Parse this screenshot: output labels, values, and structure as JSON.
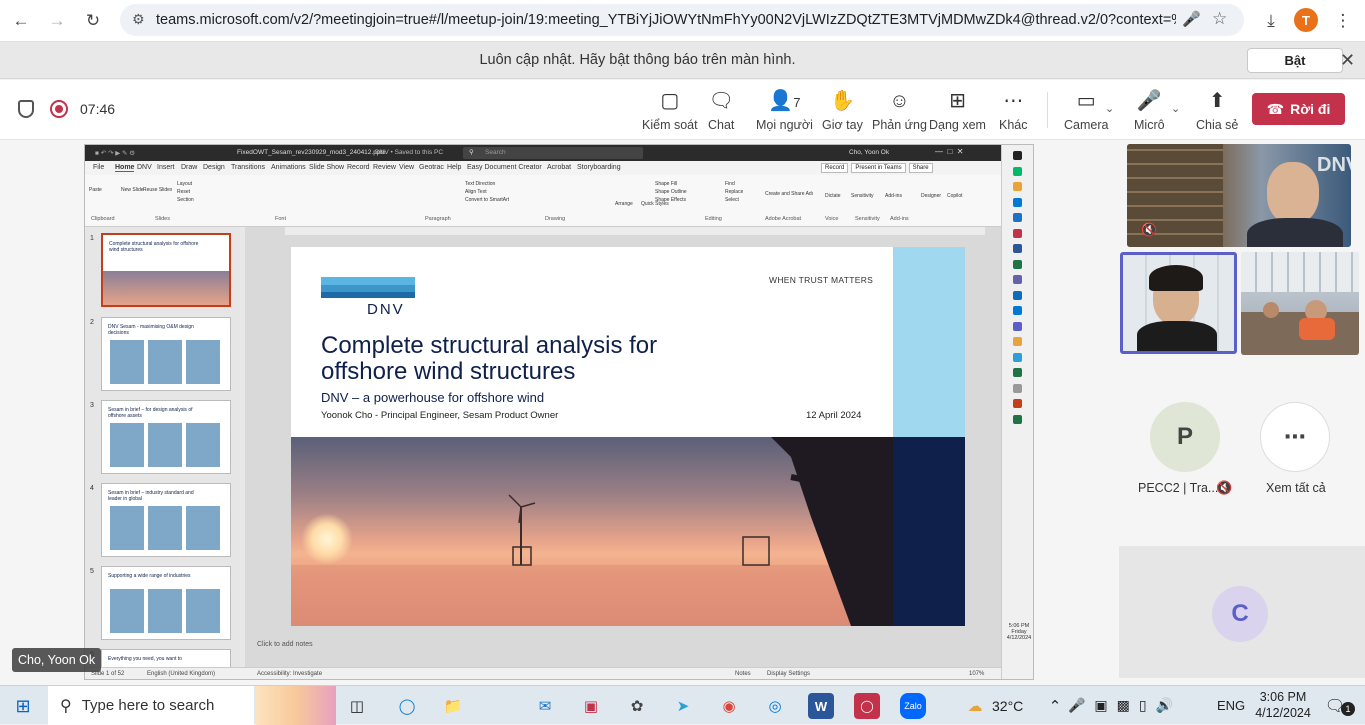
{
  "browser": {
    "url": "teams.microsoft.com/v2/?meetingjoin=true#/l/meetup-join/19:meeting_YTBiYjJiOWYtNmFhYy00N2VjLWIzZDQtZTE3MTVjMDMwZDk4@thread.v2/0?context=%7b\"...",
    "profile_initial": "T"
  },
  "notification": {
    "message": "Luôn cập nhật. Hãy bật thông báo trên màn hình.",
    "button": "Bật"
  },
  "meeting": {
    "timer": "07:46",
    "toolbar": {
      "control": "Kiểm soát",
      "chat": "Chat",
      "people": "Mọi người",
      "people_count": "7",
      "raise": "Giơ tay",
      "react": "Phản ứng",
      "view": "Dạng xem",
      "more": "Khác",
      "camera": "Camera",
      "mic": "Micrô",
      "share": "Chia sẻ",
      "leave": "Rời đi"
    },
    "presenter_name": "Cho, Yoon Ok",
    "participant_p_initial": "P",
    "participant_p_name": "PECC2 | Tra...",
    "see_all": "Xem tất cả",
    "participant_c_initial": "C",
    "dnv_wall_text": "DNV"
  },
  "powerpoint": {
    "filename": "FixedOWT_Sesam_rev230929_mod3_240412.pptx",
    "saved": "DNV • Saved to this PC",
    "search": "Search",
    "user": "Cho, Yoon Ok",
    "menu": [
      "File",
      "Home",
      "DNV",
      "Insert",
      "Draw",
      "Design",
      "Transitions",
      "Animations",
      "Slide Show",
      "Record",
      "Review",
      "View",
      "Geotrac",
      "Help",
      "Easy Document Creator",
      "Acrobat",
      "Storyboarding"
    ],
    "record_btn": "Record",
    "present_btn": "Present in Teams",
    "share_btn": "Share",
    "ribbon_groups": [
      "Clipboard",
      "Slides",
      "Font",
      "Paragraph",
      "Drawing",
      "Editing",
      "Adobe Acrobat",
      "Voice",
      "Sensitivity",
      "Add-ins"
    ],
    "ribbon_buttons": [
      "Paste",
      "New Slide",
      "Reuse Slides",
      "Layout",
      "Reset",
      "Section",
      "Text Direction",
      "Align Text",
      "Convert to SmartArt",
      "Arrange",
      "Quick Styles",
      "Shape Fill",
      "Shape Outline",
      "Shape Effects",
      "Find",
      "Replace",
      "Select",
      "Create and Share Adobe PDF",
      "Dictate",
      "Sensitivity",
      "Add-ins",
      "Designer",
      "Copilot"
    ],
    "thumbnails": [
      {
        "num": "1",
        "title": "Complete structural analysis for offshore wind structures"
      },
      {
        "num": "2",
        "title": "DNV Sesam - maximising O&M design decisions"
      },
      {
        "num": "3",
        "title": "Sesam in brief – for design analysis of offshore assets"
      },
      {
        "num": "4",
        "title": "Sesam in brief – industry standard and leader in global"
      },
      {
        "num": "5",
        "title": "Supporting a wide range of industries"
      },
      {
        "num": "6",
        "title": "Everything you need, you want to"
      }
    ],
    "notes": "Click to add notes",
    "status_slide": "Slide 1 of 52",
    "status_lang": "English (United Kingdom)",
    "status_access": "Accessibility: Investigate",
    "status_notes": "Notes",
    "status_display": "Display Settings",
    "status_zoom": "107%",
    "clock_side": "5:06 PM",
    "day_side": "Friday",
    "date_side": "4/12/2024"
  },
  "slide": {
    "logo": "DNV",
    "tagline": "WHEN TRUST MATTERS",
    "title_line1": "Complete structural analysis for",
    "title_line2": "offshore wind structures",
    "subtitle": "DNV – a powerhouse for offshore wind",
    "author": "Yoonok Cho - Principal Engineer, Sesam Product Owner",
    "date": "12 April 2024"
  },
  "taskbar": {
    "search_placeholder": "Type here to search",
    "weather": "32°C",
    "lang": "ENG",
    "time": "3:06 PM",
    "date": "4/12/2024",
    "notif_count": "1"
  },
  "colors": {
    "leave": "#c4314b",
    "dnv_navy": "#0f204b",
    "dnv_sky": "#99d9f0",
    "teams_accent": "#5b5fc7"
  }
}
